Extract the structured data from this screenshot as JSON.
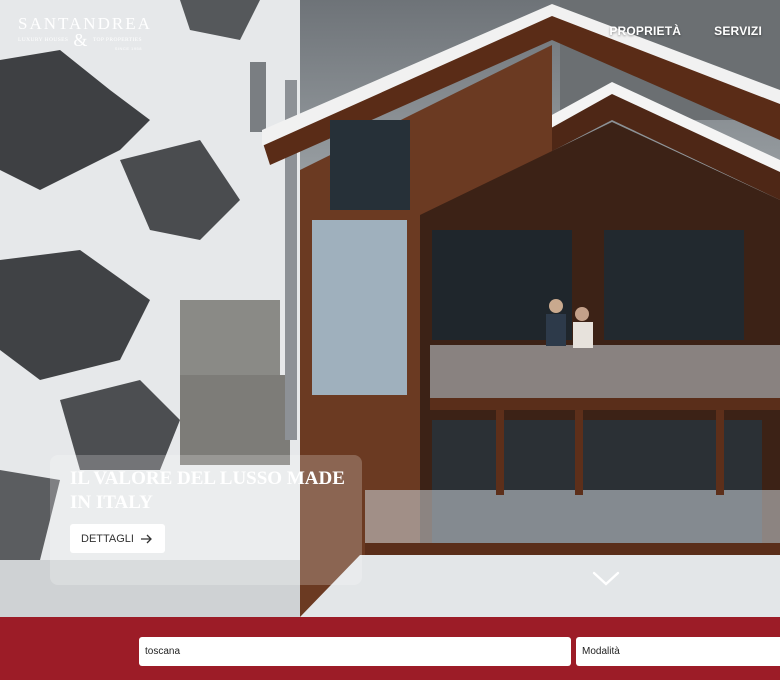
{
  "brand": {
    "name": "SANTANDREA",
    "left_sub": "LUXURY HOUSES",
    "amp": "&",
    "right_sub": "TOP PROPERTIES",
    "tag": "SINCE 1958"
  },
  "nav": {
    "items": [
      "PROPRIETÀ",
      "SERVIZI"
    ]
  },
  "hero": {
    "title": "IL VALORE DEL LUSSO MADE IN ITALY",
    "button_label": "DETTAGLI",
    "button_icon": "arrow-right-icon",
    "scroll_icon": "chevron-down-icon"
  },
  "search": {
    "location_value": "toscana",
    "mode_value": "Modalità",
    "bar_color": "#9c1c27"
  }
}
